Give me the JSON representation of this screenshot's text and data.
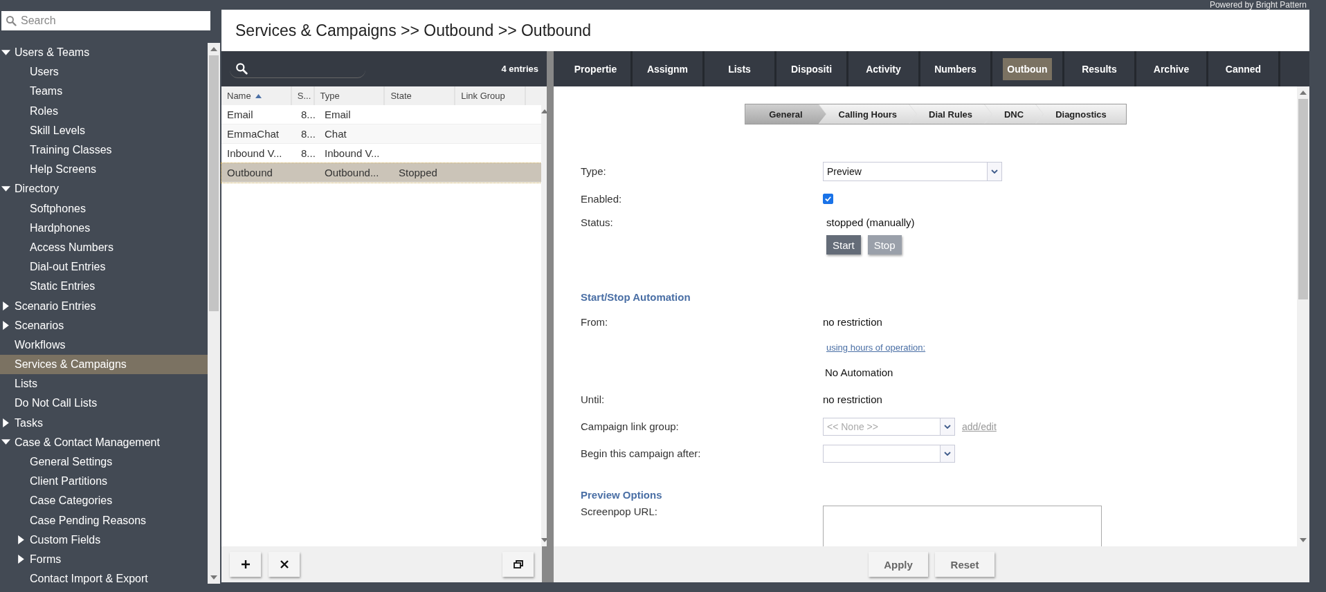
{
  "powered_by": "Powered by Bright Pattern",
  "sidebar": {
    "search": {
      "placeholder": "Search"
    },
    "tree": [
      {
        "label": "Users & Teams",
        "kind": "group",
        "expanded": true,
        "selected": false,
        "children": [
          {
            "label": "Users",
            "kind": "leaf",
            "selected": false
          },
          {
            "label": "Teams",
            "kind": "leaf",
            "selected": false
          },
          {
            "label": "Roles",
            "kind": "leaf",
            "selected": false
          },
          {
            "label": "Skill Levels",
            "kind": "leaf",
            "selected": false
          },
          {
            "label": "Training Classes",
            "kind": "leaf",
            "selected": false
          },
          {
            "label": "Help Screens",
            "kind": "leaf",
            "selected": false
          }
        ]
      },
      {
        "label": "Directory",
        "kind": "group",
        "expanded": true,
        "selected": false,
        "children": [
          {
            "label": "Softphones",
            "kind": "leaf",
            "selected": false
          },
          {
            "label": "Hardphones",
            "kind": "leaf",
            "selected": false
          },
          {
            "label": "Access Numbers",
            "kind": "leaf",
            "selected": false
          },
          {
            "label": "Dial-out Entries",
            "kind": "leaf",
            "selected": false
          },
          {
            "label": "Static Entries",
            "kind": "leaf",
            "selected": false
          }
        ]
      },
      {
        "label": "Scenario Entries",
        "kind": "group",
        "expanded": false,
        "selected": false
      },
      {
        "label": "Scenarios",
        "kind": "group",
        "expanded": false,
        "selected": false
      },
      {
        "label": "Workflows",
        "kind": "leaf",
        "selected": false
      },
      {
        "label": "Services & Campaigns",
        "kind": "leaf",
        "selected": true
      },
      {
        "label": "Lists",
        "kind": "leaf",
        "selected": false
      },
      {
        "label": "Do Not Call Lists",
        "kind": "leaf",
        "selected": false
      },
      {
        "label": "Tasks",
        "kind": "group",
        "expanded": false,
        "selected": false
      },
      {
        "label": "Case & Contact Management",
        "kind": "group",
        "expanded": true,
        "selected": false,
        "children": [
          {
            "label": "General Settings",
            "kind": "leaf",
            "selected": false
          },
          {
            "label": "Client Partitions",
            "kind": "leaf",
            "selected": false
          },
          {
            "label": "Case Categories",
            "kind": "leaf",
            "selected": false
          },
          {
            "label": "Case Pending Reasons",
            "kind": "leaf",
            "selected": false
          },
          {
            "label": "Custom Fields",
            "kind": "group",
            "expanded": false,
            "selected": false
          },
          {
            "label": "Forms",
            "kind": "group",
            "expanded": false,
            "selected": false
          },
          {
            "label": "Contact Import & Export",
            "kind": "leaf",
            "selected": false
          }
        ]
      }
    ]
  },
  "page_title": "Services & Campaigns >> Outbound >> Outbound",
  "list": {
    "count": "4 entries",
    "columns": [
      {
        "label": "Name",
        "sorted": true
      },
      {
        "label": "S...",
        "sorted": false
      },
      {
        "label": "Type",
        "sorted": false
      },
      {
        "label": "State",
        "sorted": false
      },
      {
        "label": "Link Group",
        "sorted": false
      }
    ],
    "rows": [
      {
        "cells": [
          "Email",
          "8...",
          "Email",
          "",
          ""
        ],
        "selected": false
      },
      {
        "cells": [
          "EmmaChat",
          "8...",
          "Chat",
          "",
          ""
        ],
        "selected": false
      },
      {
        "cells": [
          "Inbound V...",
          "8...",
          "Inbound V...",
          "",
          ""
        ],
        "selected": false
      },
      {
        "cells": [
          "Outbound",
          "",
          "Outbound...",
          "Stopped",
          ""
        ],
        "selected": true
      }
    ]
  },
  "tabs": [
    {
      "label": "Propertie",
      "selected": false
    },
    {
      "label": "Assignm",
      "selected": false
    },
    {
      "label": "Lists",
      "selected": false
    },
    {
      "label": "Dispositi",
      "selected": false
    },
    {
      "label": "Activity",
      "selected": false
    },
    {
      "label": "Numbers",
      "selected": false
    },
    {
      "label": "Outboun",
      "selected": true
    },
    {
      "label": "Results",
      "selected": false
    },
    {
      "label": "Archive",
      "selected": false
    },
    {
      "label": "Canned",
      "selected": false
    }
  ],
  "steps": [
    {
      "label": "General",
      "selected": true
    },
    {
      "label": "Calling Hours",
      "selected": false
    },
    {
      "label": "Dial Rules",
      "selected": false
    },
    {
      "label": "DNC",
      "selected": false
    },
    {
      "label": "Diagnostics",
      "selected": false
    }
  ],
  "form": [
    {
      "kind": "select",
      "label": "Type:",
      "value": "Preview",
      "disabled": false
    },
    {
      "kind": "checkbox",
      "label": "Enabled:",
      "checked": true
    },
    {
      "kind": "status",
      "label": "Status:",
      "value": "stopped (manually)",
      "buttons": [
        {
          "label": "Start",
          "disabled": false
        },
        {
          "label": "Stop",
          "disabled": true
        }
      ]
    },
    {
      "kind": "heading",
      "label": "Start/Stop Automation"
    },
    {
      "kind": "text",
      "label": "From:",
      "value": "no restriction"
    },
    {
      "kind": "link",
      "value": "using hours of operation:"
    },
    {
      "kind": "note",
      "value": "No Automation"
    },
    {
      "kind": "text",
      "label": "Until:",
      "value": "no restriction"
    },
    {
      "kind": "select",
      "label": "Campaign link group:",
      "value": "<< None >>",
      "disabled": true,
      "link": "add/edit"
    },
    {
      "kind": "select",
      "label": "Begin this campaign after:",
      "disabled": true
    },
    {
      "kind": "heading",
      "label": "Preview Options"
    },
    {
      "kind": "textarea",
      "label": "Screenpop URL:"
    }
  ],
  "footer_buttons": [
    "Apply",
    "Reset"
  ]
}
